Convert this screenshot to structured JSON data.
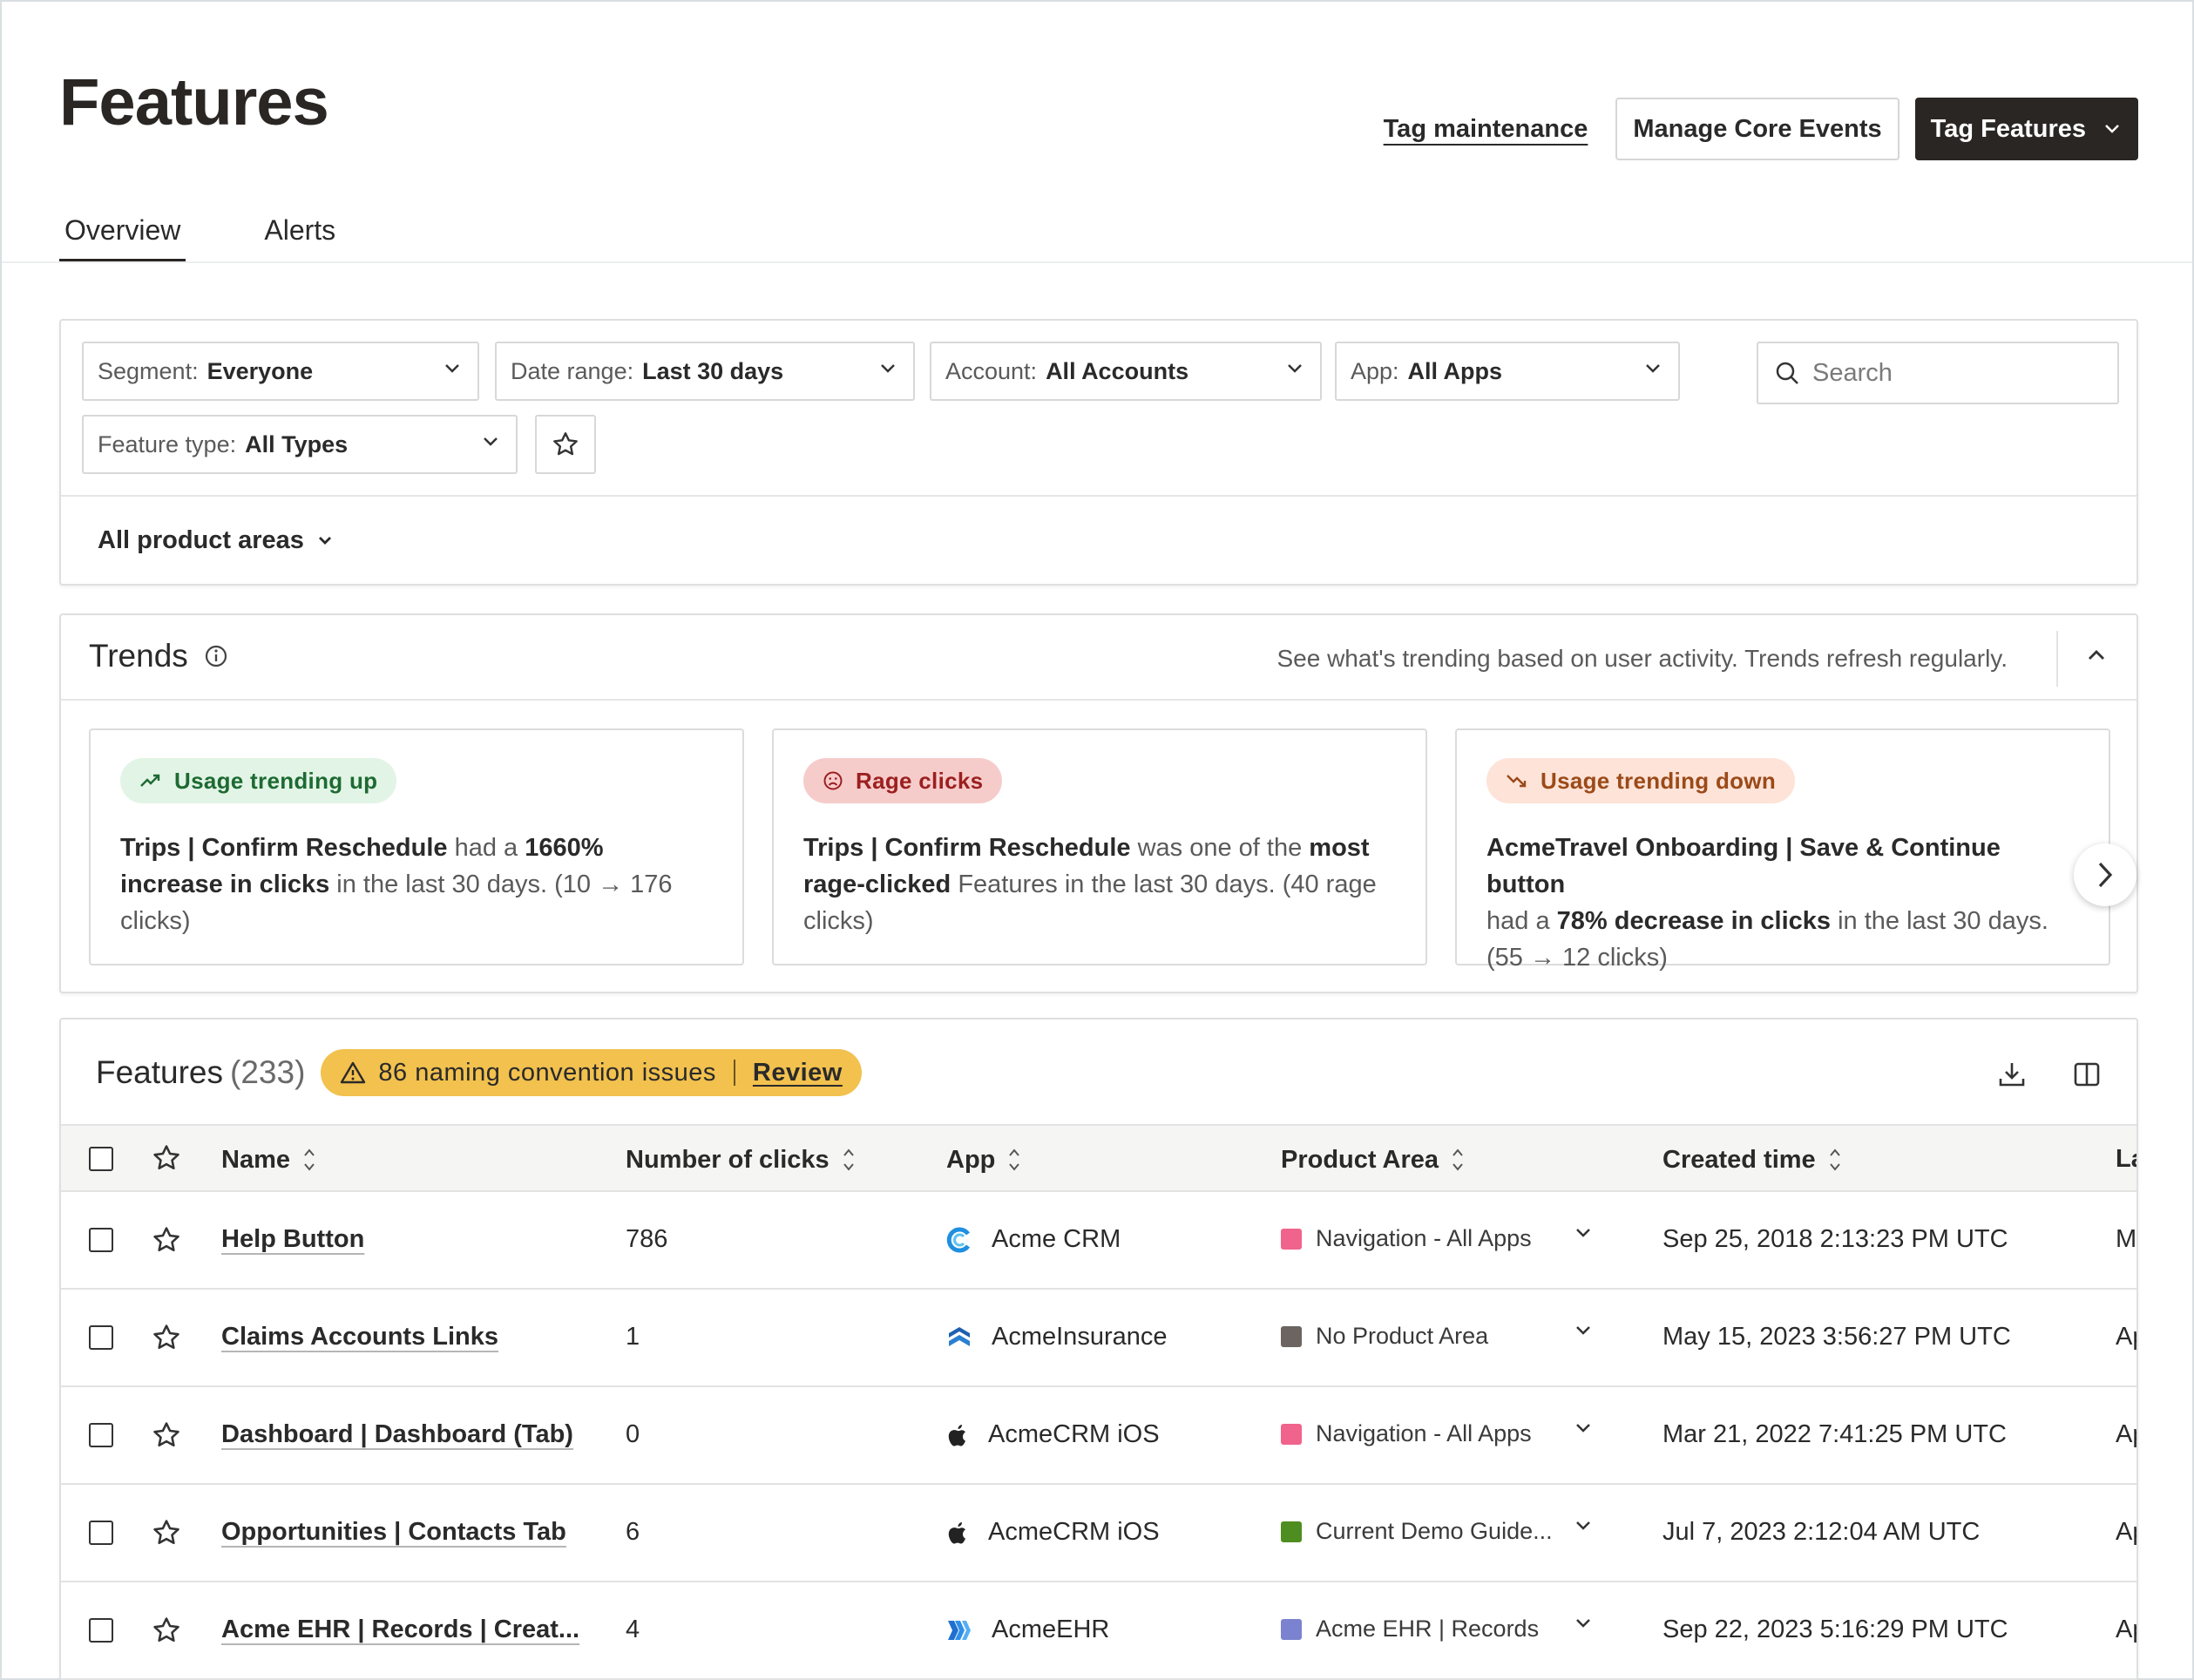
{
  "page": {
    "title": "Features",
    "actions": {
      "tag_maintenance": "Tag maintenance",
      "manage_core_events": "Manage Core Events",
      "tag_features": "Tag Features"
    },
    "tabs": [
      "Overview",
      "Alerts"
    ]
  },
  "filters": {
    "segment": {
      "label": "Segment:",
      "value": "Everyone"
    },
    "date_range": {
      "label": "Date range:",
      "value": "Last 30 days"
    },
    "account": {
      "label": "Account:",
      "value": "All Accounts"
    },
    "app": {
      "label": "App:",
      "value": "All Apps"
    },
    "feature_type": {
      "label": "Feature type:",
      "value": "All Types"
    },
    "search_placeholder": "Search",
    "product_areas": "All product areas"
  },
  "trends": {
    "title": "Trends",
    "description": "See what's trending based on user activity. Trends refresh regularly.",
    "cards": [
      {
        "badge": "Usage trending up",
        "feature": "Trips | Confirm Reschedule",
        "pre": " had a ",
        "highlight": "1660% increase in clicks",
        "post": " in the last 30 days. (10 → 176 clicks)"
      },
      {
        "badge": "Rage clicks",
        "feature": "Trips | Confirm Reschedule",
        "pre": " was one of the ",
        "highlight": "most rage-clicked",
        "post": " Features in the last 30 days. (40 rage clicks)"
      },
      {
        "badge": "Usage trending down",
        "feature": "AcmeTravel Onboarding | Save & Continue button",
        "pre": " had a ",
        "highlight": "78% decrease in clicks",
        "post": " in the last 30 days. (55 → 12 clicks)"
      }
    ]
  },
  "features_table": {
    "title": "Features",
    "count": "(233)",
    "issues": "86 naming convention issues",
    "review": "Review",
    "columns": [
      "Name",
      "Number of clicks",
      "App",
      "Product Area",
      "Created time",
      "La"
    ],
    "rows": [
      {
        "name": "Help Button",
        "clicks": "786",
        "app": "Acme CRM",
        "app_icon": "acme-crm-icon",
        "area": "Navigation - All Apps",
        "area_color": "#f0638c",
        "created": "Sep 25, 2018 2:13:23 PM UTC",
        "last": "M"
      },
      {
        "name": "Claims Accounts Links",
        "clicks": "1",
        "app": "AcmeInsurance",
        "app_icon": "acme-insurance-icon",
        "area": "No Product Area",
        "area_color": "#6b6461",
        "created": "May 15, 2023 3:56:27 PM UTC",
        "last": "Ap"
      },
      {
        "name": "Dashboard | Dashboard (Tab)",
        "clicks": "0",
        "app": "AcmeCRM iOS",
        "app_icon": "apple-icon",
        "area": "Navigation - All Apps",
        "area_color": "#f0638c",
        "created": "Mar 21, 2022 7:41:25 PM UTC",
        "last": "Ap"
      },
      {
        "name": "Opportunities | Contacts Tab",
        "clicks": "6",
        "app": "AcmeCRM iOS",
        "app_icon": "apple-icon",
        "area": "Current Demo Guide...",
        "area_color": "#4e8d1f",
        "created": "Jul 7, 2023 2:12:04 AM UTC",
        "last": "Ap"
      },
      {
        "name": "Acme EHR | Records | Creat...",
        "clicks": "4",
        "app": "AcmeEHR",
        "app_icon": "acme-ehr-icon",
        "area": "Acme EHR | Records",
        "area_color": "#7b83d0",
        "created": "Sep 22, 2023 5:16:29 PM UTC",
        "last": "Ap"
      }
    ]
  }
}
